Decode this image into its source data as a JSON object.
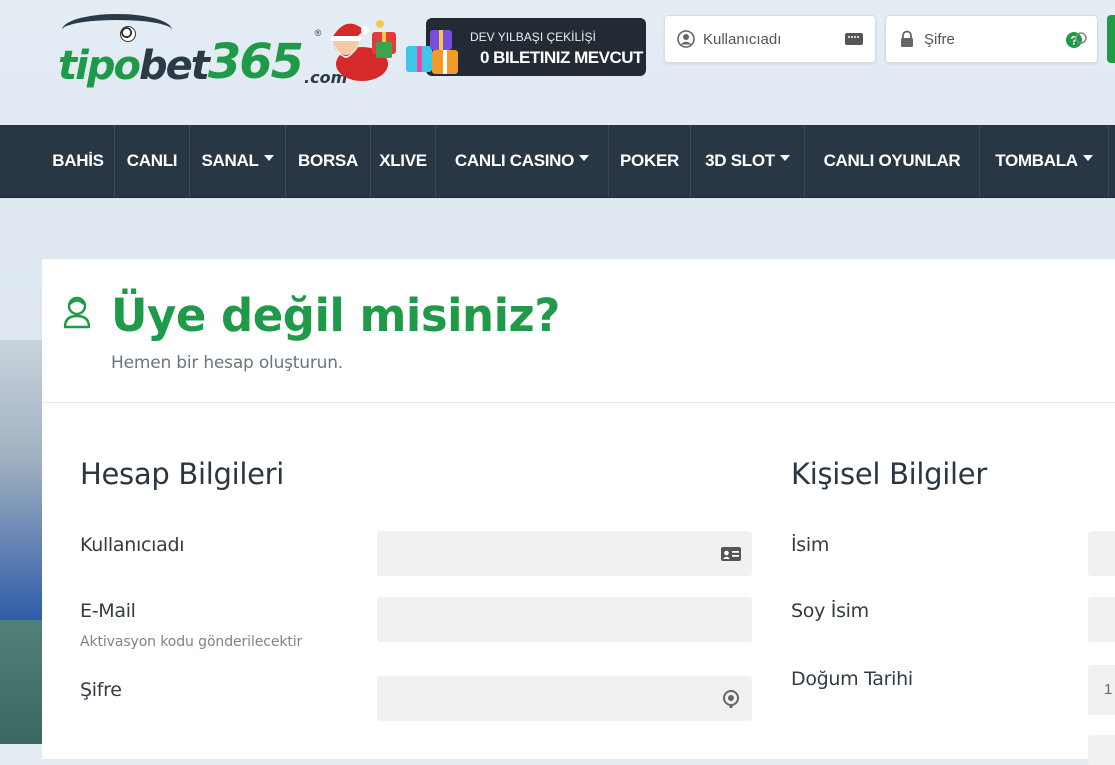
{
  "logo": {
    "part1": "tipo",
    "part2": "bet",
    "part3": "365",
    "part4": ".com",
    "reg": "®"
  },
  "promo": {
    "line1": "DEV YILBAŞI ÇEKİLİŞİ",
    "line2": "0 BILETINIZ MEVCUT"
  },
  "login": {
    "username_placeholder": "Kullanıcıadı",
    "password_placeholder": "Şifre"
  },
  "nav": [
    {
      "label": "BAHİS",
      "caret": false
    },
    {
      "label": "CANLI",
      "caret": false
    },
    {
      "label": "SANAL",
      "caret": true
    },
    {
      "label": "BORSA",
      "caret": false
    },
    {
      "label": "XLIVE",
      "caret": false
    },
    {
      "label": "CANLI CASINO",
      "caret": true
    },
    {
      "label": "POKER",
      "caret": false
    },
    {
      "label": "3D SLOT",
      "caret": true
    },
    {
      "label": "CANLI OYUNLAR",
      "caret": false
    },
    {
      "label": "TOMBALA",
      "caret": true
    }
  ],
  "page": {
    "title": "Üye değil misiniz?",
    "subtitle": "Hemen bir hesap oluşturun."
  },
  "account": {
    "title": "Hesap Bilgileri",
    "username_label": "Kullanıcıadı",
    "email_label": "E-Mail",
    "email_hint": "Aktivasyon kodu gönderilecektir",
    "password_label": "Şifre"
  },
  "personal": {
    "title": "Kişisel Bilgiler",
    "name_label": "İsim",
    "surname_label": "Soy İsim",
    "birth_label": "Doğum Tarihi",
    "birth_value_fragment": "1"
  },
  "colors": {
    "brand_green": "#1f9a48",
    "nav_bg": "#293744",
    "field_bg": "#f0f1f2"
  }
}
